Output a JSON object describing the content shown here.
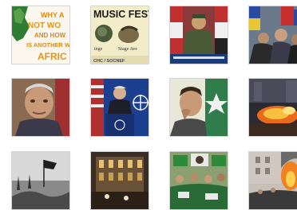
{
  "grid": {
    "thumbnails": [
      {
        "id": "t1",
        "text": {
          "line1": "WHY A",
          "line2": "NOT WO",
          "line3": "AND HOW",
          "line4": "IS ANOTHER WA",
          "line5": "AFRIC"
        }
      },
      {
        "id": "t2",
        "text": {
          "title": "MUSIC FEST",
          "line_a": "inge",
          "line_b": "Stage Ave",
          "footer": "CHC / SOCNEF"
        }
      },
      {
        "id": "t3",
        "text": {}
      },
      {
        "id": "t4",
        "text": {}
      },
      {
        "id": "t5",
        "text": {}
      },
      {
        "id": "t6",
        "text": {}
      },
      {
        "id": "t7",
        "text": {}
      },
      {
        "id": "t8",
        "text": {}
      },
      {
        "id": "t9",
        "text": {}
      },
      {
        "id": "t10",
        "text": {}
      },
      {
        "id": "t11",
        "text": {}
      },
      {
        "id": "t12",
        "text": {}
      }
    ]
  },
  "colors": {
    "thumb_border": "#d6d6d6",
    "africa_orange": "#e8a33b",
    "africa_green": "#2e7d32",
    "fest_cream": "#f2ecc8"
  }
}
